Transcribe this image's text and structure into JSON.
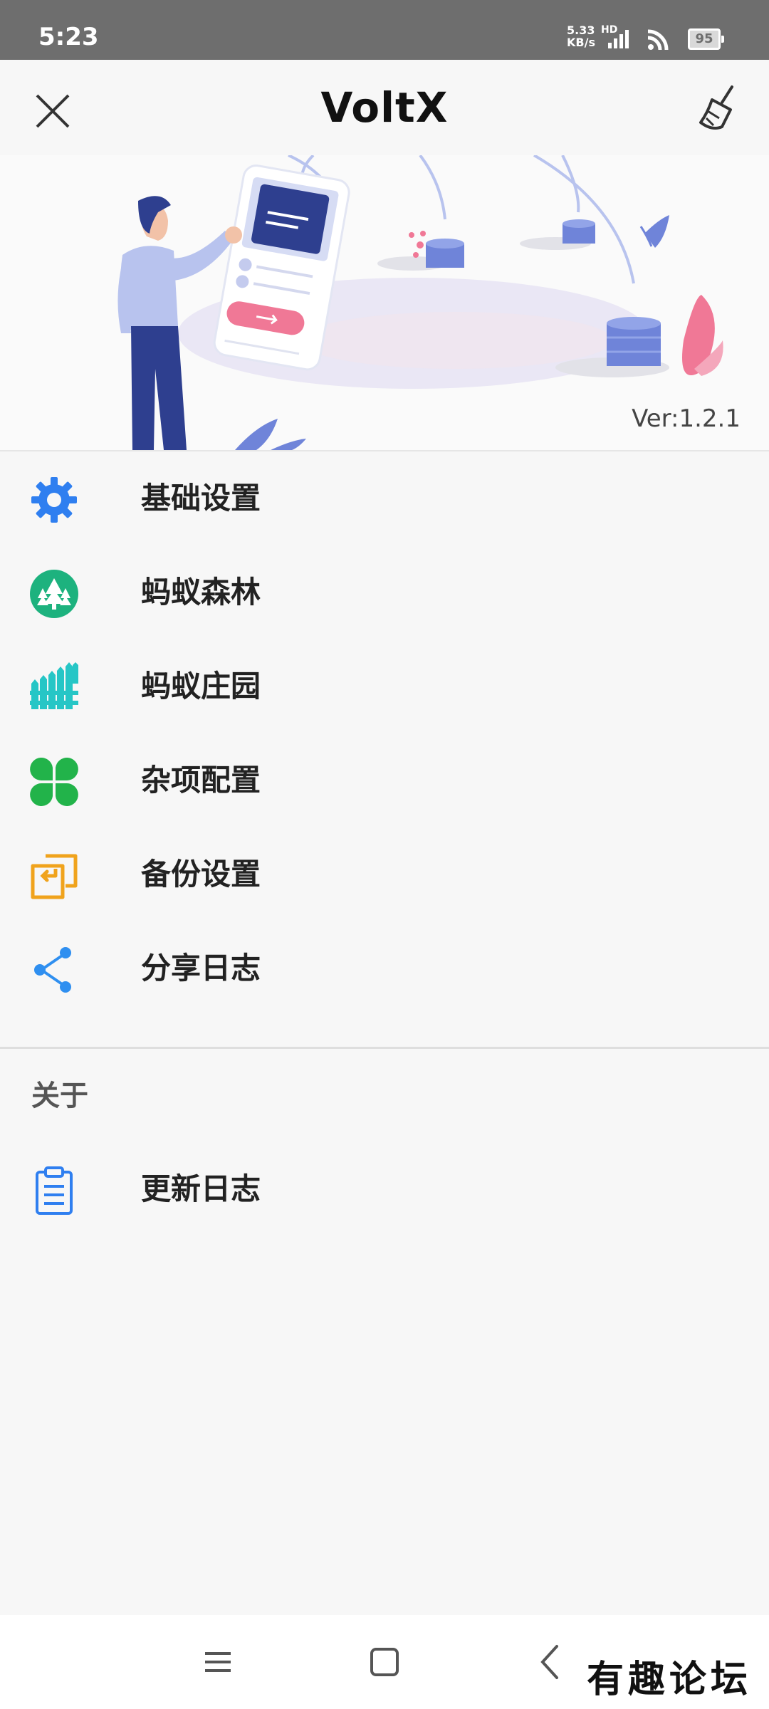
{
  "status_bar": {
    "time": "5:23",
    "net_speed": "5.33 KB/s",
    "hd": "HD",
    "battery": "95"
  },
  "header": {
    "title": "VoltX",
    "close_icon": "close-icon",
    "clean_icon": "broom-icon"
  },
  "banner": {
    "version": "Ver:1.2.1"
  },
  "menu": {
    "items": [
      {
        "label": "基础设置",
        "icon": "gear-icon",
        "color": "#2f7ff0"
      },
      {
        "label": "蚂蚁森林",
        "icon": "tree-icon",
        "color": "#1db27e"
      },
      {
        "label": "蚂蚁庄园",
        "icon": "fence-icon",
        "color": "#26c6c6"
      },
      {
        "label": "杂项配置",
        "icon": "clover-icon",
        "color": "#22b34a"
      },
      {
        "label": "备份设置",
        "icon": "backup-icon",
        "color": "#f0a31c"
      },
      {
        "label": "分享日志",
        "icon": "share-icon",
        "color": "#2f8ff0"
      }
    ]
  },
  "about": {
    "section_title": "关于",
    "items": [
      {
        "label": "更新日志",
        "icon": "clipboard-icon",
        "color": "#2f7ff0"
      }
    ]
  },
  "nav_bar": {
    "menu_icon": "menu-icon",
    "home_icon": "home-icon",
    "back_icon": "back-icon"
  },
  "watermark": "有趣论坛"
}
